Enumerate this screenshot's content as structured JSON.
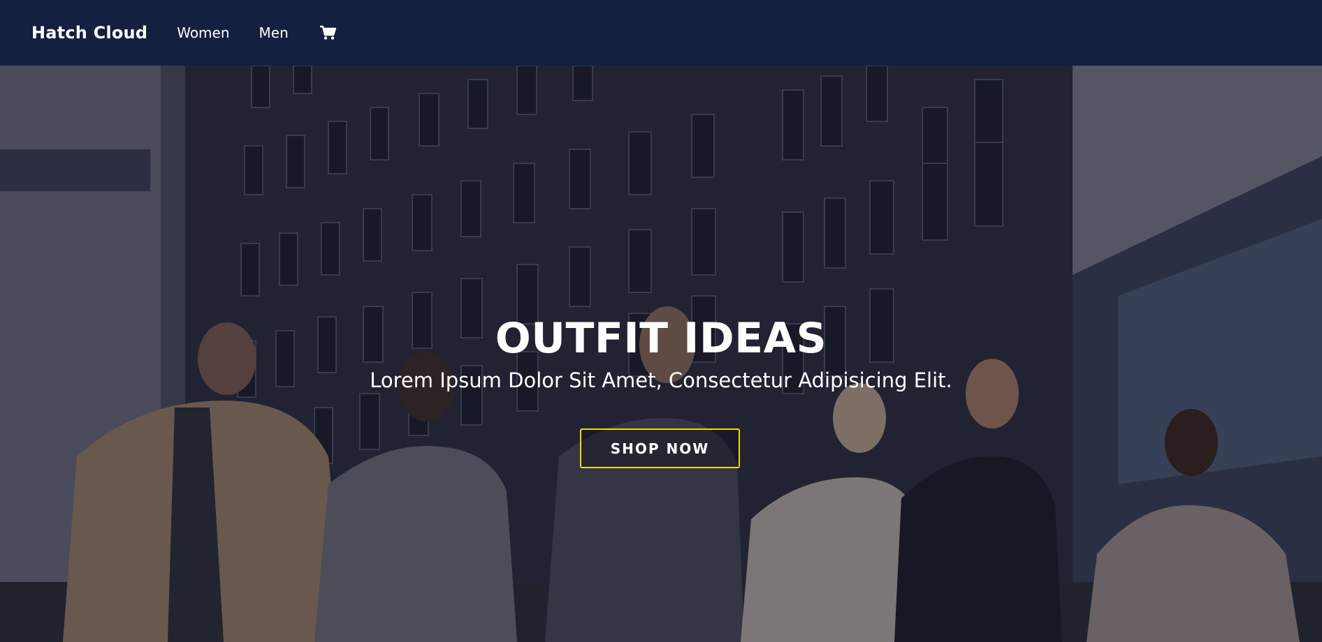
{
  "navbar": {
    "brand": "Hatch Cloud",
    "links": [
      "Women",
      "Men"
    ],
    "cart_icon": "shopping-cart-icon"
  },
  "hero": {
    "title": "OUTFIT IDEAS",
    "subtitle": "Lorem Ipsum Dolor Sit Amet, Consectetur Adipisicing Elit.",
    "cta_label": "SHOP NOW",
    "cta_border_color": "#f5d90a",
    "background_image": "group of business people walking with coffee cups in front of office buildings"
  },
  "colors": {
    "navbar_bg": "#13203f",
    "text": "#ffffff",
    "accent": "#f5d90a"
  }
}
